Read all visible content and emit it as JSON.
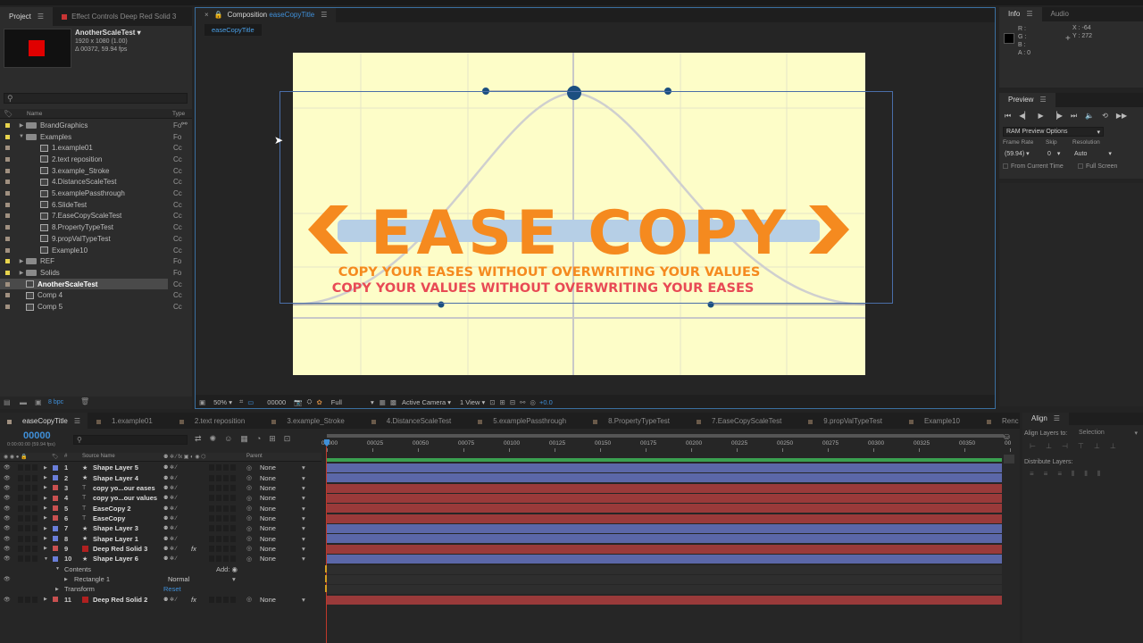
{
  "project": {
    "tabs": [
      "Project",
      "Effect Controls Deep Red Solid 3"
    ],
    "comp_name": "AnotherScaleTest",
    "comp_res": "1920 x 1080 (1.00)",
    "comp_dur": "Δ 00372, 59.94 fps",
    "search_placeholder": "",
    "col_name": "Name",
    "col_type": "Type",
    "items": [
      {
        "label": "BrandGraphics",
        "type": "Fo",
        "kind": "folder",
        "color": "#e8d44d",
        "expanded": false,
        "indent": 0
      },
      {
        "label": "Examples",
        "type": "Fo",
        "kind": "folder",
        "color": "#e8d44d",
        "expanded": true,
        "indent": 0
      },
      {
        "label": "1.example01",
        "type": "Cc",
        "kind": "comp",
        "color": "#a09080",
        "indent": 1
      },
      {
        "label": "2.text reposition",
        "type": "Cc",
        "kind": "comp",
        "color": "#a09080",
        "indent": 1
      },
      {
        "label": "3.example_Stroke",
        "type": "Cc",
        "kind": "comp",
        "color": "#a09080",
        "indent": 1
      },
      {
        "label": "4.DistanceScaleTest",
        "type": "Cc",
        "kind": "comp",
        "color": "#a09080",
        "indent": 1
      },
      {
        "label": "5.examplePassthrough",
        "type": "Cc",
        "kind": "comp",
        "color": "#a09080",
        "indent": 1
      },
      {
        "label": "6.SlideTest",
        "type": "Cc",
        "kind": "comp",
        "color": "#a09080",
        "indent": 1
      },
      {
        "label": "7.EaseCopyScaleTest",
        "type": "Cc",
        "kind": "comp",
        "color": "#a09080",
        "indent": 1
      },
      {
        "label": "8.PropertyTypeTest",
        "type": "Cc",
        "kind": "comp",
        "color": "#a09080",
        "indent": 1
      },
      {
        "label": "9.propValTypeTest",
        "type": "Cc",
        "kind": "comp",
        "color": "#a09080",
        "indent": 1
      },
      {
        "label": "Example10",
        "type": "Cc",
        "kind": "comp",
        "color": "#a09080",
        "indent": 1
      },
      {
        "label": "REF",
        "type": "Fo",
        "kind": "folder",
        "color": "#e8d44d",
        "expanded": false,
        "indent": 0
      },
      {
        "label": "Solids",
        "type": "Fo",
        "kind": "folder",
        "color": "#e8d44d",
        "expanded": false,
        "indent": 0
      },
      {
        "label": "AnotherScaleTest",
        "type": "Cc",
        "kind": "comp",
        "color": "#a09080",
        "indent": 0,
        "selected": true
      },
      {
        "label": "Comp 4",
        "type": "Cc",
        "kind": "comp",
        "color": "#a09080",
        "indent": 0
      },
      {
        "label": "Comp 5",
        "type": "Cc",
        "kind": "comp",
        "color": "#a09080",
        "indent": 0
      }
    ],
    "bpc": "8 bpc"
  },
  "composition": {
    "tab_prefix": "Composition",
    "tab_name": "easeCopyTitle",
    "subtab": "easeCopyTitle",
    "canvas": {
      "title": "EASE COPY",
      "line1": "COPY YOUR EASES WITHOUT OVERWRITING YOUR VALUES",
      "line2": "COPY YOUR VALUES WITHOUT OVERWRITING YOUR EASES",
      "bg": "#fdfdc8",
      "orange": "#f58a1f",
      "red": "#e84a55",
      "blue": "#b6cfe6",
      "dot": "#1b4f80"
    },
    "footer": {
      "zoom": "50%",
      "timecode": "00000",
      "resolution": "Full",
      "camera": "Active Camera",
      "views": "1 View",
      "exposure": "+0.0"
    }
  },
  "info": {
    "tabs": [
      "Info",
      "Audio"
    ],
    "r": "R :",
    "g": "G :",
    "b": "B :",
    "a": "A : 0",
    "x": "X : -64",
    "y": "Y : 272"
  },
  "preview": {
    "tab": "Preview",
    "ram": "RAM Preview Options",
    "frame_rate_label": "Frame Rate",
    "skip_label": "Skip",
    "resolution_label": "Resolution",
    "frame_rate": "(59.94)",
    "skip": "0",
    "resolution": "Auto",
    "from_current": "From Current Time",
    "full_screen": "Full Screen"
  },
  "timeline": {
    "tabs": [
      "easeCopyTitle",
      "1.example01",
      "2.text reposition",
      "3.example_Stroke",
      "4.DistanceScaleTest",
      "5.examplePassthrough",
      "8.PropertyTypeTest",
      "7.EaseCopyScaleTest",
      "9.propValTypeTest",
      "Example10",
      "Renc"
    ],
    "timecode": "00000",
    "timecode_sub": "0:00:00:00 (59.94 fps)",
    "col_num": "#",
    "col_source": "Source Name",
    "col_parent": "Parent",
    "ruler": [
      "00000",
      "00025",
      "00050",
      "00075",
      "00100",
      "00125",
      "00150",
      "00175",
      "00200",
      "00225",
      "00250",
      "00275",
      "00300",
      "00325",
      "00350",
      "00"
    ],
    "layers": [
      {
        "num": "1",
        "name": "Shape Layer 5",
        "kind": "shape",
        "color": "#6a7ed8",
        "parent": "None"
      },
      {
        "num": "2",
        "name": "Shape Layer 4",
        "kind": "shape",
        "color": "#6a7ed8",
        "parent": "None"
      },
      {
        "num": "3",
        "name": "copy yo...our eases",
        "kind": "text",
        "color": "#c85050",
        "parent": "None"
      },
      {
        "num": "4",
        "name": "copy yo...our values",
        "kind": "text",
        "color": "#c85050",
        "parent": "None"
      },
      {
        "num": "5",
        "name": "EaseCopy 2",
        "kind": "text",
        "color": "#c85050",
        "parent": "None"
      },
      {
        "num": "6",
        "name": "EaseCopy",
        "kind": "text",
        "color": "#c85050",
        "parent": "None"
      },
      {
        "num": "7",
        "name": "Shape Layer 3",
        "kind": "shape",
        "color": "#6a7ed8",
        "parent": "None"
      },
      {
        "num": "8",
        "name": "Shape Layer 1",
        "kind": "shape",
        "color": "#6a7ed8",
        "parent": "None"
      },
      {
        "num": "9",
        "name": "Deep Red Solid 3",
        "kind": "solid",
        "color": "#c85050",
        "parent": "None"
      },
      {
        "num": "10",
        "name": "Shape Layer 6",
        "kind": "shape",
        "color": "#6a7ed8",
        "parent": "None"
      }
    ],
    "contents": "Contents",
    "add": "Add:",
    "rect": "Rectangle 1",
    "blend": "Normal",
    "transform": "Transform",
    "reset": "Reset",
    "layer11": {
      "num": "11",
      "name": "Deep Red Solid 2",
      "kind": "solid",
      "color": "#c85050",
      "parent": "None"
    }
  },
  "align": {
    "tab": "Align",
    "align_to_label": "Align Layers to:",
    "align_to": "Selection",
    "distribute": "Distribute Layers:"
  }
}
